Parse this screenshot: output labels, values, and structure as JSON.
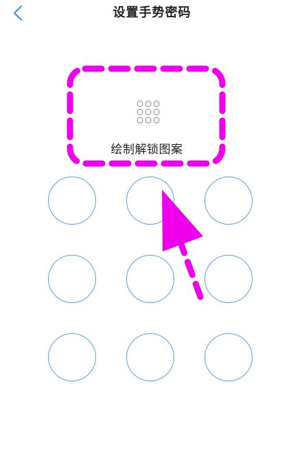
{
  "header": {
    "title": "设置手势密码",
    "back_icon": "chevron-left-icon"
  },
  "preview": {
    "label": "绘制解锁图案",
    "icon": "pattern-grid-icon"
  },
  "pattern": {
    "rows": 3,
    "cols": 3,
    "dot_color": "#5aa0e6"
  },
  "colors": {
    "accent": "#3a8ee6",
    "annotation": "#ee00ee",
    "text": "#222222",
    "mini_grid": "#9a9a9a"
  }
}
